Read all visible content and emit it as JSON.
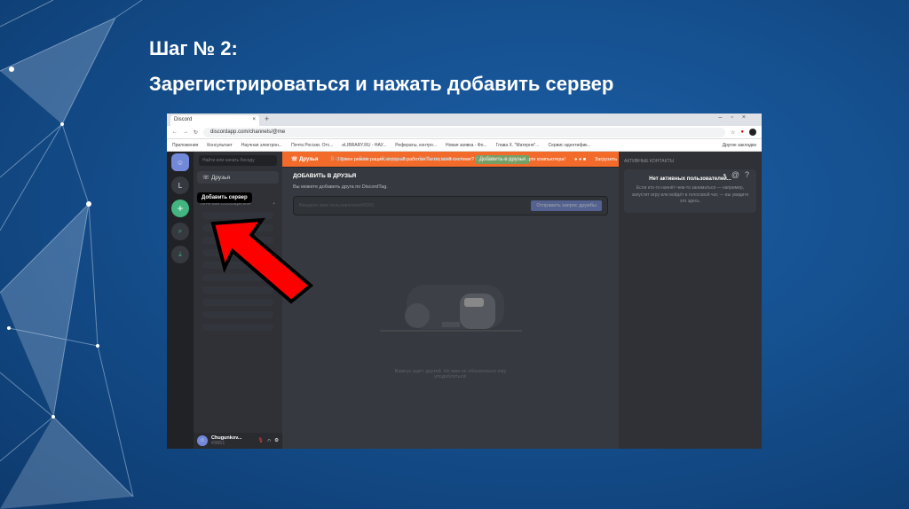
{
  "slide": {
    "step": "Шаг № 2:",
    "instruction": "Зарегистрироваться и нажать добавить сервер"
  },
  "browser": {
    "tab": "Discord",
    "url": "discordapp.com/channels/@me",
    "bookmarks": [
      "Приложения",
      "Консультант",
      "Научная электрон...",
      "Почта России. Отс...",
      "eLIBRARY.RU - НАУ...",
      "Рефераты, контро...",
      "Новая заявка - Фо...",
      "Глава Х. \"Матерня\"...",
      "Сервис идентифик...",
      "Другие закладки"
    ]
  },
  "discord": {
    "banner": {
      "text": "Нужен режим рации, который работал бы по всей системе? Скачайте приложение для компьютера!",
      "button": "Загрузить"
    },
    "rail": {
      "home_letter": "L",
      "tooltip": "Добавить сервер"
    },
    "sidebar": {
      "search_placeholder": "Найти или начать беседу",
      "friends": "Друзья",
      "dm_header": "ЛИЧНЫЕ СООБЩЕНИЯ",
      "username": "Chugunkov...",
      "tag": "#3651"
    },
    "header": {
      "friends": "Друзья",
      "tabs": [
        "В сети",
        "Все",
        "Ожидание",
        "Заблокированные"
      ],
      "add_friend": "Добавить в друзья"
    },
    "add_friend": {
      "title": "ДОБАВИТЬ В ДРУЗЬЯ",
      "desc": "Вы можете добавить друга по DiscordTag.",
      "placeholder": "Введите имя пользователя#0000",
      "send": "Отправить запрос дружбы"
    },
    "empty": "Вампус ждёт друзей. Но вам не обязательно ему уподобляться!",
    "active": {
      "title": "АКТИВНЫЕ КОНТАКТЫ",
      "none": "Нет активных пользователей...",
      "desc": "Если кто-то начнёт чем-то заниматься — например, запустит игру или войдёт в голосовой чат, — вы увидите это здесь."
    }
  },
  "colors": {
    "blurple": "#7289da",
    "green": "#43b581",
    "orange": "#f26b2b",
    "arrow": "#ff0000"
  }
}
